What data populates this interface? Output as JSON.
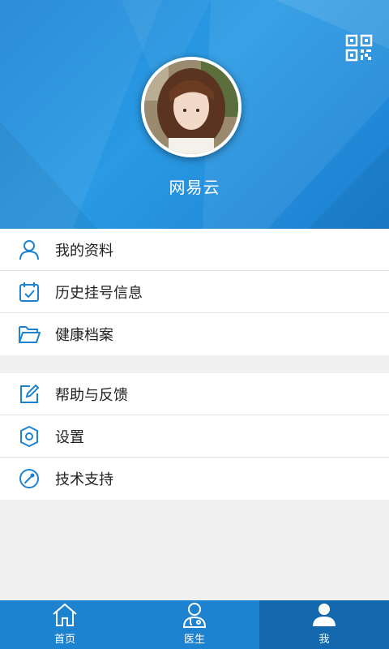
{
  "profile": {
    "name": "网易云",
    "qr_icon": "qr-code-icon",
    "avatar": "user-avatar-photo"
  },
  "menu_group_1": [
    {
      "label": "我的资料",
      "icon": "user-icon"
    },
    {
      "label": "历史挂号信息",
      "icon": "calendar-check-icon"
    },
    {
      "label": "健康档案",
      "icon": "folder-icon"
    }
  ],
  "menu_group_2": [
    {
      "label": "帮助与反馈",
      "icon": "edit-icon"
    },
    {
      "label": "设置",
      "icon": "gear-icon"
    },
    {
      "label": "技术支持",
      "icon": "compass-icon"
    }
  ],
  "tabbar": {
    "tabs": [
      {
        "label": "首页",
        "icon": "home-icon",
        "active": false
      },
      {
        "label": "医生",
        "icon": "doctor-icon",
        "active": false
      },
      {
        "label": "我",
        "icon": "person-icon",
        "active": true
      }
    ]
  },
  "colors": {
    "header": "#2a9ae4",
    "accent": "#1d83d1",
    "tab_active": "#1468ad",
    "icon": "#1d83d1"
  }
}
